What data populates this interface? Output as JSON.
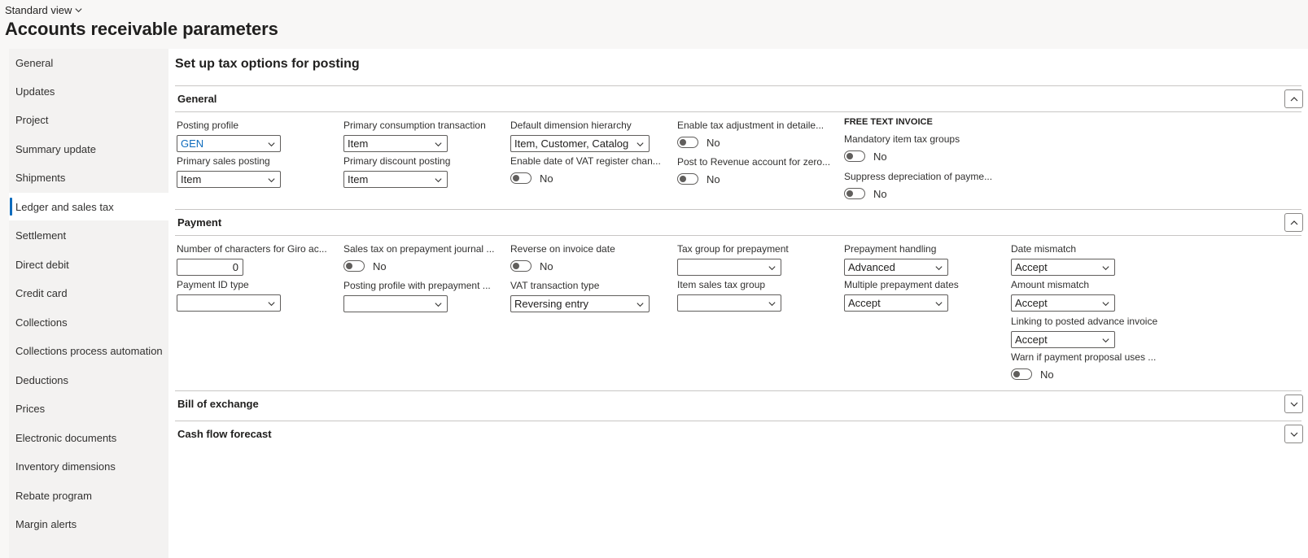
{
  "header": {
    "view_label": "Standard view",
    "title": "Accounts receivable parameters"
  },
  "sidebar": {
    "items": [
      {
        "label": "General"
      },
      {
        "label": "Updates"
      },
      {
        "label": "Project"
      },
      {
        "label": "Summary update"
      },
      {
        "label": "Shipments"
      },
      {
        "label": "Ledger and sales tax",
        "active": true
      },
      {
        "label": "Settlement"
      },
      {
        "label": "Direct debit"
      },
      {
        "label": "Credit card"
      },
      {
        "label": "Collections"
      },
      {
        "label": "Collections process automation"
      },
      {
        "label": "Deductions"
      },
      {
        "label": "Prices"
      },
      {
        "label": "Electronic documents"
      },
      {
        "label": "Inventory dimensions"
      },
      {
        "label": "Rebate program"
      },
      {
        "label": "Margin alerts"
      }
    ]
  },
  "main": {
    "section_title": "Set up tax options for posting",
    "general": {
      "title": "General",
      "posting_profile": {
        "label": "Posting profile",
        "value": "GEN"
      },
      "primary_sales_posting": {
        "label": "Primary sales posting",
        "value": "Item"
      },
      "primary_consumption": {
        "label": "Primary consumption transaction",
        "value": "Item"
      },
      "primary_discount": {
        "label": "Primary discount posting",
        "value": "Item"
      },
      "default_dimension_hierarchy": {
        "label": "Default dimension hierarchy",
        "value": "Item, Customer, Catalog"
      },
      "enable_date_vat": {
        "label": "Enable date of VAT register chan...",
        "value": "No"
      },
      "enable_tax_adjustment": {
        "label": "Enable tax adjustment in detaile...",
        "value": "No"
      },
      "post_to_revenue": {
        "label": "Post to Revenue account for zero...",
        "value": "No"
      },
      "free_text_invoice_heading": "FREE TEXT INVOICE",
      "mandatory_item_tax": {
        "label": "Mandatory item tax groups",
        "value": "No"
      },
      "suppress_depreciation": {
        "label": "Suppress depreciation of payme...",
        "value": "No"
      }
    },
    "payment": {
      "title": "Payment",
      "giro_chars": {
        "label": "Number of characters for Giro ac...",
        "value": "0"
      },
      "payment_id_type": {
        "label": "Payment ID type",
        "value": ""
      },
      "sales_tax_prepayment": {
        "label": "Sales tax on prepayment journal ...",
        "value": "No"
      },
      "posting_profile_prepayment": {
        "label": "Posting profile with prepayment ...",
        "value": ""
      },
      "reverse_on_invoice_date": {
        "label": "Reverse on invoice date",
        "value": "No"
      },
      "vat_transaction_type": {
        "label": "VAT transaction type",
        "value": "Reversing entry"
      },
      "tax_group_prepayment": {
        "label": "Tax group for prepayment",
        "value": ""
      },
      "item_sales_tax_group": {
        "label": "Item sales tax group",
        "value": ""
      },
      "prepayment_handling": {
        "label": "Prepayment handling",
        "value": "Advanced"
      },
      "multiple_prepayment_dates": {
        "label": "Multiple prepayment dates",
        "value": "Accept"
      },
      "date_mismatch": {
        "label": "Date mismatch",
        "value": "Accept"
      },
      "amount_mismatch": {
        "label": "Amount mismatch",
        "value": "Accept"
      },
      "linking_posted_advance": {
        "label": "Linking to posted advance invoice",
        "value": "Accept"
      },
      "warn_payment_proposal": {
        "label": "Warn if payment proposal uses ...",
        "value": "No"
      }
    },
    "bill_of_exchange": {
      "title": "Bill of exchange"
    },
    "cash_flow_forecast": {
      "title": "Cash flow forecast"
    }
  }
}
